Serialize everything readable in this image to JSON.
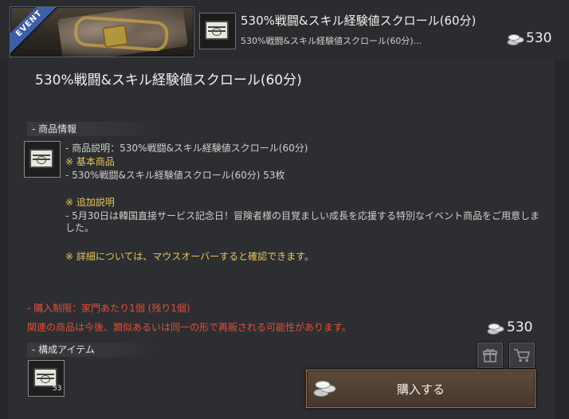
{
  "header": {
    "event_badge": "EVENT",
    "title": "530%戦闘&スキル経験値スクロール(60分)",
    "subtitle": "530%戦闘&スキル経験値スクロール(60分)...",
    "price": "530"
  },
  "detail": {
    "title": "530%戦闘&スキル経験値スクロール(60分)",
    "info_section_label": "- 商品情報",
    "lines": [
      "- 商品説明：530%戦闘&スキル経験値スクロール(60分)",
      "※ 基本商品",
      "- 530%戦闘&スキル経験値スクロール(60分) 53枚",
      "※ 追加説明",
      "- 5月30日は韓国直接サービス記念日！冒険者様の目覚ましい成長を応援する特別なイベント商品をご用意しました。",
      "※ 詳細については、マウスオーバーすると確認できます。"
    ],
    "purchase_limit": "- 購入制限：家門あたり1個 (残り1個)",
    "resale_notice": "関連の商品は今後、類似あるいは同一の形で再販される可能性があります。",
    "price": "530",
    "components_section_label": "- 構成アイテム",
    "component_count": "53",
    "buy_button_label": "購入する"
  },
  "icons": {
    "event": "event-ribbon",
    "item": "scroll-icon",
    "currency": "silver-coins-icon",
    "gift": "gift-icon",
    "cart": "cart-icon"
  },
  "colors": {
    "background": "#26272a",
    "panel": "#2d2e31",
    "notice_yellow": "#e8c65a",
    "warning_red": "#e0503a",
    "event_blue": "#3d5ea8",
    "buy_border": "#9c7a55"
  }
}
